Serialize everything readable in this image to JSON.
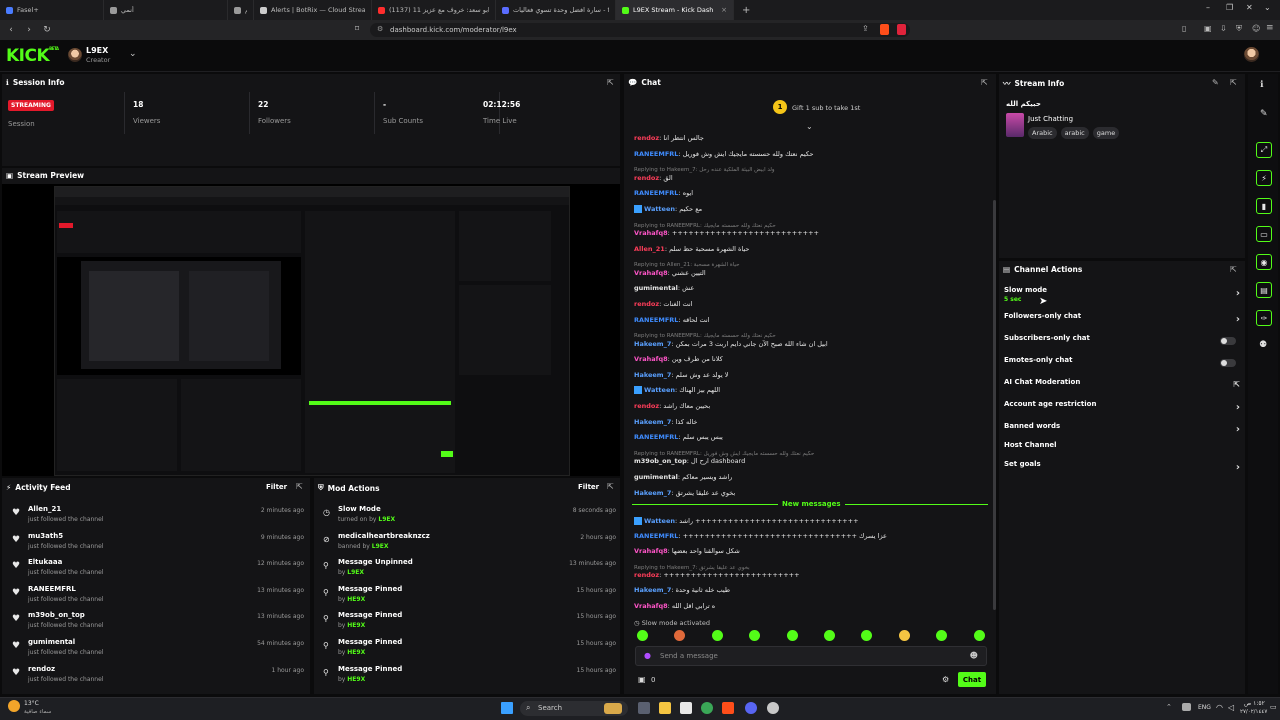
{
  "browser": {
    "tabs": [
      {
        "label": "Fasel+",
        "color": "#4a7cff"
      },
      {
        "label": "أنمي",
        "color": "#9a9a9a"
      },
      {
        "label": "استيقهم",
        "color": "#9a9a9a"
      },
      {
        "label": "Alerts | BotRix — Cloud Streaming B",
        "color": "#cccccc"
      },
      {
        "label": "(1137) ابو سعد: خروف مع عزيز 11#",
        "color": "#ff2d2d"
      },
      {
        "label": "سارة افضل وحدة تسوي فعاليات - tion",
        "color": "#5a6cff"
      },
      {
        "label": "L9EX Stream - Kick Dashboard",
        "color": "#53fc18"
      }
    ],
    "active_tab_close": "×",
    "new_tab": "+",
    "url": "dashboard.kick.com/moderator/l9ex"
  },
  "header": {
    "logo": "KICK",
    "logo_badge": "BETA",
    "username": "L9EX",
    "role": "Creator"
  },
  "session": {
    "title": "Session Info",
    "status_badge": "STREAMING",
    "stats": [
      {
        "value": "18",
        "label": "Viewers"
      },
      {
        "value": "22",
        "label": "Followers"
      },
      {
        "value": "-",
        "label": "Sub Counts"
      },
      {
        "value": "02:12:56",
        "label": "Time Live"
      }
    ],
    "session_label": "Session"
  },
  "preview": {
    "title": "Stream Preview"
  },
  "activity": {
    "title": "Activity Feed",
    "filter": "Filter",
    "items": [
      {
        "name": "Allen_21",
        "desc": "just followed the channel",
        "time": "2 minutes ago"
      },
      {
        "name": "mu3ath5",
        "desc": "just followed the channel",
        "time": "9 minutes ago"
      },
      {
        "name": "Eltukaaa",
        "desc": "just followed the channel",
        "time": "12 minutes ago"
      },
      {
        "name": "RANEEMFRL",
        "desc": "just followed the channel",
        "time": "13 minutes ago"
      },
      {
        "name": "m39ob_on_top",
        "desc": "just followed the channel",
        "time": "13 minutes ago"
      },
      {
        "name": "gumimental",
        "desc": "just followed the channel",
        "time": "54 minutes ago"
      },
      {
        "name": "rendoz",
        "desc": "just followed the channel",
        "time": "1 hour ago"
      }
    ]
  },
  "mod": {
    "title": "Mod Actions",
    "filter": "Filter",
    "items": [
      {
        "action": "Slow Mode",
        "pre": "turned on by",
        "by": "L9EX",
        "time": "8 seconds ago",
        "icon": "slow-mode-icon"
      },
      {
        "action": "medicalheartbreaknzcz",
        "pre": "banned by",
        "by": "L9EX",
        "time": "2 hours ago",
        "icon": "ban-icon"
      },
      {
        "action": "Message Unpinned",
        "pre": "by",
        "by": "L9EX",
        "time": "13 minutes ago",
        "icon": "unpin-icon"
      },
      {
        "action": "Message Pinned",
        "pre": "by",
        "by": "HE9X",
        "time": "15 hours ago",
        "icon": "pin-icon"
      },
      {
        "action": "Message Pinned",
        "pre": "by",
        "by": "HE9X",
        "time": "15 hours ago",
        "icon": "pin-icon"
      },
      {
        "action": "Message Pinned",
        "pre": "by",
        "by": "HE9X",
        "time": "15 hours ago",
        "icon": "pin-icon"
      },
      {
        "action": "Message Pinned",
        "pre": "by",
        "by": "HE9X",
        "time": "15 hours ago",
        "icon": "pin-icon"
      }
    ]
  },
  "chat": {
    "title": "Chat",
    "gift_text": "Gift 1 sub to take 1st",
    "gift_count": "1",
    "messages": [
      {
        "user": "rendoz",
        "color": "#ff3d5a",
        "text": "جالس انتظر انا"
      },
      {
        "user": "RANEEMFRL",
        "color": "#3f8cff",
        "text": "حكيم نعتك ولله حسسته مايجيك ايش وش فوريل"
      },
      {
        "reply": "Replying to Hakeem_7: ولد ابيض البيئة الملكية عنده رحل"
      },
      {
        "user": "rendoz",
        "color": "#ff3d5a",
        "text": "الق"
      },
      {
        "user": "RANEEMFRL",
        "color": "#3f8cff",
        "text": "ايوه"
      },
      {
        "user": "Watteen",
        "color": "#5aa0ff",
        "text": "مع حكيم"
      },
      {
        "reply": "Replying to RANEEMFRL: حكيم نعتك ولله حسسته مايجيك"
      },
      {
        "user": "Vrahafq8",
        "color": "#ff55c8",
        "text": "+++++++++++++++++++++++++++"
      },
      {
        "user": "Allen_21",
        "color": "#ff3d5a",
        "text": "حياة الشهرة مسحبة حظ سلم"
      },
      {
        "reply": "Replying to Allen_21: حياة الشهرة مسحبة"
      },
      {
        "user": "Vrahafq8",
        "color": "#ff55c8",
        "text": "التيين عشني"
      },
      {
        "user": "gumimental",
        "color": "#e6e6e6",
        "text": "عش"
      },
      {
        "user": "rendoz",
        "color": "#ff3d5a",
        "text": "انت الغنات"
      },
      {
        "user": "RANEEMFRL",
        "color": "#3f8cff",
        "text": "انت لحاقه"
      },
      {
        "reply": "Replying to RANEEMFRL: حكيم نعتك ولله حسسته مايجيك"
      },
      {
        "user": "Hakeem_7",
        "color": "#5aa0ff",
        "text": "ابيل ان شاء الله صبح الآن جاني دايم اربت 3 مرات بمكن"
      },
      {
        "user": "Vrahafq8",
        "color": "#ff55c8",
        "text": "كلانا من طرف وين"
      },
      {
        "user": "Hakeem_7",
        "color": "#5aa0ff",
        "text": "لا يولد عد وش سلم"
      },
      {
        "user": "Watteen",
        "color": "#5aa0ff",
        "text": "اللهم بيز الهناك"
      },
      {
        "user": "rendoz",
        "color": "#ff3d5a",
        "text": "بحيبن معاك راشد"
      },
      {
        "user": "Hakeem_7",
        "color": "#5aa0ff",
        "text": "خاله كذا"
      },
      {
        "user": "RANEEMFRL",
        "color": "#3f8cff",
        "text": "يبس يبس سلم"
      },
      {
        "reply": "Replying to RANEEMFRL: حكيم نعتك ولله حسسته مايجيك ايش وش فوريل"
      },
      {
        "user": "m39ob_on_top",
        "color": "#e6e6e6",
        "text": "ارح ال dashboard"
      },
      {
        "user": "gumimental",
        "color": "#e6e6e6",
        "text": "راشد ويسير معاكم"
      },
      {
        "user": "Hakeem_7",
        "color": "#5aa0ff",
        "text": "بخوي عد عليقا يشرتق"
      }
    ],
    "new_messages_label": "New messages",
    "new_messages": [
      {
        "user": "Watteen",
        "color": "#5aa0ff",
        "text": "راشد ++++++++++++++++++++++++++++++"
      },
      {
        "user": "RANEEMFRL",
        "color": "#3f8cff",
        "text": "++++++++++++++++++++++++++++++++ عزا يسرك"
      },
      {
        "user": "Vrahafq8",
        "color": "#ff55c8",
        "text": "شكل سوالقنا واحد بعضها"
      },
      {
        "reply": "Replying to Hakeem_7: بخوي عد عليقا يشرتق"
      },
      {
        "user": "rendoz",
        "color": "#ff3d5a",
        "text": "+++++++++++++++++++++++++"
      },
      {
        "user": "Hakeem_7",
        "color": "#5aa0ff",
        "text": "طيب خله ثانية وحدة"
      },
      {
        "user": "Vrahafq8",
        "color": "#ff55c8",
        "text": "ه ترابي اقل الله"
      }
    ],
    "slow_mode_notice": "Slow mode activated",
    "input_placeholder": "Send a message",
    "points": "0",
    "send_button": "Chat"
  },
  "stream_info": {
    "title": "Stream Info",
    "stream_title": "حبيكم الله",
    "category": "Just Chatting",
    "tags": [
      "Arabic",
      "arabic",
      "game"
    ]
  },
  "channel_actions": {
    "title": "Channel Actions",
    "slow_mode_value": "5 sec",
    "items": [
      {
        "label": "Slow mode",
        "control": "chevron"
      },
      {
        "label": "Followers-only chat",
        "control": "chevron"
      },
      {
        "label": "Subscribers-only chat",
        "control": "toggle"
      },
      {
        "label": "Emotes-only chat",
        "control": "toggle"
      },
      {
        "label": "AI Chat Moderation",
        "control": "external"
      },
      {
        "label": "Account age restriction",
        "control": "chevron"
      },
      {
        "label": "Banned words",
        "control": "chevron"
      },
      {
        "label": "Host Channel",
        "control": "none"
      },
      {
        "label": "Set goals",
        "control": "chevron"
      }
    ]
  },
  "taskbar": {
    "weather_temp": "13°C",
    "weather_desc": "سماء صافية",
    "search": "Search",
    "lang": "ENG",
    "time": "١:٥٢ ص",
    "date": "٢٧/٠٢/١٤٤٧"
  }
}
